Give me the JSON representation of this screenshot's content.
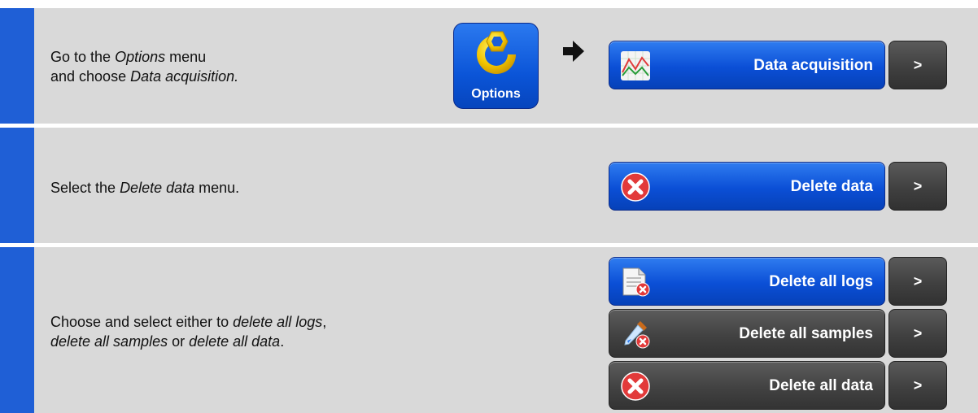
{
  "colors": {
    "accent": "#1f5fd6",
    "step_bg": "#d9d9d9",
    "button_blue": "#0b4fd6",
    "button_dark": "#424242",
    "delete_red": "#e23a3a"
  },
  "step1": {
    "line1_pre": "Go to the ",
    "line1_em": "Options",
    "line1_post": " menu",
    "line2_pre": "and choose ",
    "line2_em": "Data acquisition.",
    "options_tile": {
      "label": "Options",
      "icon": "wrench-icon"
    },
    "arrow_icon": "arrow-right-icon",
    "button": {
      "label": "Data acquisition",
      "icon": "chart-icon",
      "arrow": ">"
    }
  },
  "step2": {
    "text_pre": "Select the ",
    "text_em": "Delete data",
    "text_post": " menu.",
    "button": {
      "label": "Delete data",
      "icon": "delete-icon",
      "arrow": ">"
    }
  },
  "step3": {
    "line1_pre": "Choose and select either to ",
    "line1_em": "delete all logs",
    "line1_post": ",",
    "line2_em1": "delete all samples",
    "line2_mid": " or ",
    "line2_em2": "delete all data",
    "line2_post": ".",
    "buttons": [
      {
        "label": "Delete all logs",
        "icon": "document-delete-icon",
        "arrow": ">",
        "style": "blue"
      },
      {
        "label": "Delete all samples",
        "icon": "pipette-delete-icon",
        "arrow": ">",
        "style": "dark"
      },
      {
        "label": "Delete all data",
        "icon": "delete-icon",
        "arrow": ">",
        "style": "dark"
      }
    ]
  }
}
